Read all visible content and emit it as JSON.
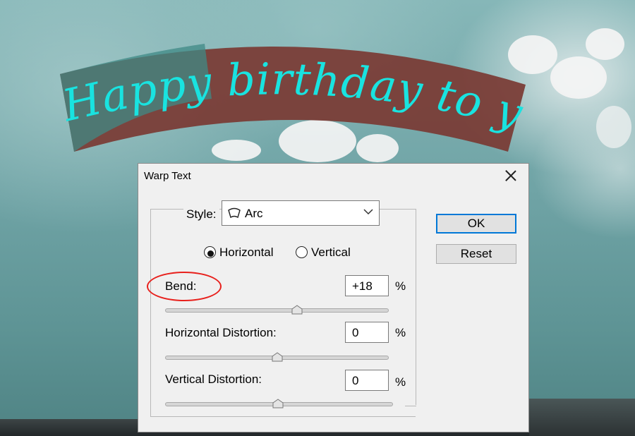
{
  "canvas": {
    "warped_text": "Happy birthday to you",
    "text_color": "#19e3e0",
    "band_color": "#7a3a33"
  },
  "dialog": {
    "title": "Warp Text",
    "style": {
      "label": "Style:",
      "value": "Arc"
    },
    "orientation": {
      "horizontal_label": "Horizontal",
      "vertical_label": "Vertical",
      "selected": "Horizontal"
    },
    "bend": {
      "label": "Bend:",
      "value": "+18",
      "unit": "%",
      "percent": 18
    },
    "horizontal_distortion": {
      "label": "Horizontal Distortion:",
      "value": "0",
      "unit": "%",
      "percent": 0
    },
    "vertical_distortion": {
      "label": "Vertical Distortion:",
      "value": "0",
      "unit": "%",
      "percent": 0
    },
    "buttons": {
      "ok": "OK",
      "reset": "Reset"
    }
  },
  "colors": {
    "annotation": "#e8201c",
    "focus": "#0078d7"
  }
}
